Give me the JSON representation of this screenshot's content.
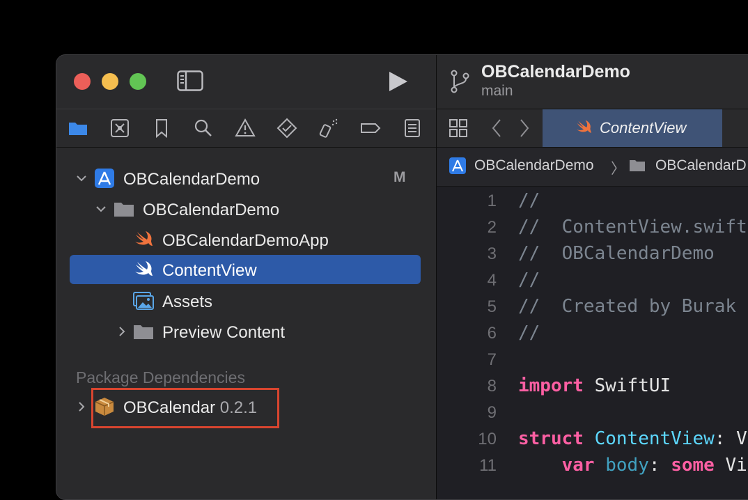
{
  "project": {
    "name": "OBCalendarDemo",
    "branch": "main"
  },
  "navigator": {
    "root": {
      "label": "OBCalendarDemo",
      "badge": "M"
    },
    "group": {
      "label": "OBCalendarDemo"
    },
    "files": [
      {
        "label": "OBCalendarDemoApp",
        "icon": "swift-icon"
      },
      {
        "label": "ContentView",
        "icon": "swift-icon",
        "selected": true
      },
      {
        "label": "Assets",
        "icon": "assets-icon"
      }
    ],
    "preview": {
      "label": "Preview Content"
    },
    "package_section": "Package Dependencies",
    "package": {
      "name": "OBCalendar",
      "version": "0.2.1"
    },
    "nav_icons": [
      "folder-icon",
      "source-control-icon",
      "bookmark-icon",
      "search-icon",
      "warning-icon",
      "test-icon",
      "debug-icon",
      "breakpoint-icon",
      "report-icon"
    ]
  },
  "editor": {
    "tab_label": "ContentView",
    "jump_bar": {
      "item1": "OBCalendarDemo",
      "separator": "〉",
      "item2": "OBCalendarD"
    },
    "lines": [
      {
        "n": "1",
        "parts": [
          [
            "c-comment",
            "//"
          ]
        ]
      },
      {
        "n": "2",
        "parts": [
          [
            "c-comment",
            "//  ContentView.swift"
          ]
        ]
      },
      {
        "n": "3",
        "parts": [
          [
            "c-comment",
            "//  OBCalendarDemo"
          ]
        ]
      },
      {
        "n": "4",
        "parts": [
          [
            "c-comment",
            "//"
          ]
        ]
      },
      {
        "n": "5",
        "parts": [
          [
            "c-comment",
            "//  Created by Burak"
          ]
        ]
      },
      {
        "n": "6",
        "parts": [
          [
            "c-comment",
            "//"
          ]
        ]
      },
      {
        "n": "7",
        "parts": []
      },
      {
        "n": "8",
        "parts": [
          [
            "c-kw",
            "import"
          ],
          [
            "c-plain",
            " SwiftUI"
          ]
        ]
      },
      {
        "n": "9",
        "parts": []
      },
      {
        "n": "10",
        "parts": [
          [
            "c-kw",
            "struct"
          ],
          [
            "c-plain",
            " "
          ],
          [
            "c-type",
            "ContentView"
          ],
          [
            "c-plain",
            ": View {"
          ]
        ]
      },
      {
        "n": "11",
        "parts": [
          [
            "c-plain",
            "    "
          ],
          [
            "c-kw",
            "var"
          ],
          [
            "c-plain",
            " "
          ],
          [
            "c-decl",
            "body"
          ],
          [
            "c-plain",
            ": "
          ],
          [
            "c-kw",
            "some"
          ],
          [
            "c-plain",
            " View"
          ]
        ]
      }
    ]
  },
  "colors": {
    "selection": "#2d5aa8",
    "highlight_box": "#d8452f",
    "tab_active": "#3f5376"
  }
}
